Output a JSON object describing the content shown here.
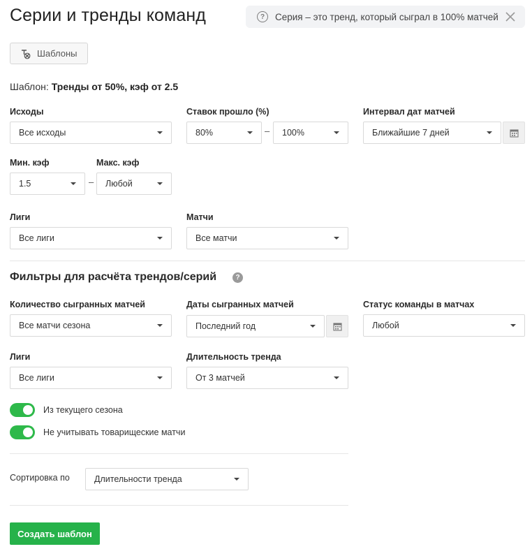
{
  "page": {
    "title": "Серии и тренды команд",
    "hint_text": "Серия – это тренд, который сыграл в 100% матчей"
  },
  "templates_button": {
    "label": "Шаблоны"
  },
  "current_template": {
    "prefix": "Шаблон:",
    "name": "Тренды от 50%, кэф от 2.5"
  },
  "match_filters": {
    "outcomes": {
      "label": "Исходы",
      "value": "Все исходы"
    },
    "bets_passed": {
      "label": "Ставок прошло (%)",
      "from": "80%",
      "to": "100%"
    },
    "date_interval": {
      "label": "Интервал дат матчей",
      "value": "Ближайшие 7 дней"
    },
    "min_odds": {
      "label": "Мин. кэф",
      "value": "1.5"
    },
    "max_odds": {
      "label": "Макс. кэф",
      "value": "Любой"
    },
    "leagues": {
      "label": "Лиги",
      "value": "Все лиги"
    },
    "matches": {
      "label": "Матчи",
      "value": "Все матчи"
    }
  },
  "trend_filters": {
    "title": "Фильтры для расчёта трендов/серий",
    "played_count": {
      "label": "Количество сыгранных матчей",
      "value": "Все матчи сезона"
    },
    "played_dates": {
      "label": "Даты сыгранных матчей",
      "value": "Последний год"
    },
    "team_status": {
      "label": "Статус команды в матчах",
      "value": "Любой"
    },
    "leagues": {
      "label": "Лиги",
      "value": "Все лиги"
    },
    "trend_length": {
      "label": "Длительность тренда",
      "value": "От 3 матчей"
    }
  },
  "toggles": [
    {
      "label": "Из текущего сезона",
      "on": true
    },
    {
      "label": "Не учитывать товарищеские матчи",
      "on": true
    }
  ],
  "sort": {
    "label": "Сортировка по",
    "value": "Длительности тренда"
  },
  "create_button": {
    "label": "Создать шаблон"
  },
  "colors": {
    "accent": "#26b24a",
    "toggle_on": "#2eb94a"
  },
  "separator": "–"
}
